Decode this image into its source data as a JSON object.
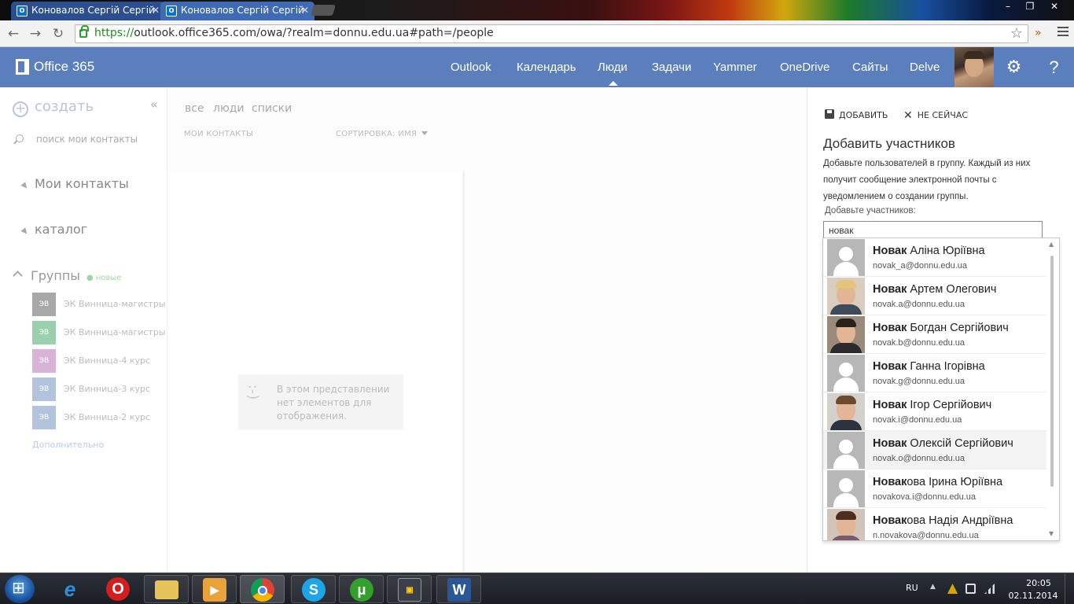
{
  "browser": {
    "tabs": [
      {
        "title": "Коновалов Сергій Сергій",
        "active": false
      },
      {
        "title": "Коновалов Сергій Сергій",
        "active": true
      }
    ],
    "tab_icon_text": "O",
    "url_scheme": "https://",
    "url_rest": "outlook.office365.com/owa/?realm=donnu.edu.ua#path=/people",
    "ext_chevron": "»"
  },
  "o365": {
    "brand": "Office 365",
    "nav": [
      "Outlook",
      "Календарь",
      "Люди",
      "Задачи",
      "Yammer",
      "OneDrive",
      "Сайты",
      "Delve"
    ],
    "active_nav": "Люди",
    "settings_glyph": "⚙",
    "help_glyph": "?"
  },
  "left_pane": {
    "create_label": "создать",
    "collapse_glyph": "«",
    "search_placeholder": "поиск мои контакты",
    "my_contacts": "Мои контакты",
    "directory": "каталог",
    "groups_label": "Группы",
    "groups_new_badge": "● новые",
    "groups": [
      {
        "initials": "ЭВ",
        "name": "ЭК Винница-магистры з",
        "color": "#a8a8a8"
      },
      {
        "initials": "ЭВ",
        "name": "ЭК Винница-магистры д",
        "color": "#9ccfae"
      },
      {
        "initials": "ЭВ",
        "name": "ЭК Винница-4 курс",
        "color": "#d8b3d9"
      },
      {
        "initials": "ЭВ",
        "name": "ЭК Винница-3 курс",
        "color": "#b2c3de"
      },
      {
        "initials": "ЭВ",
        "name": "ЭК Винница-2 курс",
        "color": "#b2c3de"
      }
    ],
    "more_link": "Дополнительно"
  },
  "middle_pane": {
    "filters": [
      "все",
      "люди",
      "списки"
    ],
    "my_contacts_header": "МОИ КОНТАКТЫ",
    "sort_label": "СОРТИРОВКА: ИМЯ",
    "empty_face": ":-)",
    "empty_message": "В этом представлении нет элементов для отображения."
  },
  "right_pane": {
    "save_label": "ДОБАВИТЬ",
    "dismiss_label": "НЕ СЕЙЧАС",
    "title": "Добавить участников",
    "description": "Добавьте пользователей в группу. Каждый из них получит сообщение электронной почты с уведомлением о создании группы.",
    "add_members_label": "Добавьте участников:",
    "input_value": "новак"
  },
  "suggestions": {
    "query_bold": "Новак",
    "items": [
      {
        "bold": "Новак",
        "rest": " Аліна Юріївна",
        "email": "novak_a@donnu.edu.ua",
        "photo": "placeholder"
      },
      {
        "bold": "Новак",
        "rest": " Артем Олегович",
        "email": "novak.a@donnu.edu.ua",
        "photo": "blond"
      },
      {
        "bold": "Новак",
        "rest": " Богдан Сергійович",
        "email": "novak.b@donnu.edu.ua",
        "photo": "dark"
      },
      {
        "bold": "Новак",
        "rest": " Ганна Ігорівна",
        "email": "novak.g@donnu.edu.ua",
        "photo": "placeholder"
      },
      {
        "bold": "Новак",
        "rest": " Ігор Сергійович",
        "email": "novak.i@donnu.edu.ua",
        "photo": "suit"
      },
      {
        "bold": "Новак",
        "rest": " Олексій Сергійович",
        "email": "novak.o@donnu.edu.ua",
        "photo": "placeholder",
        "highlighted": true
      },
      {
        "bold": "Новак",
        "rest": "ова Ірина Юріївна",
        "email": "novakova.i@donnu.edu.ua",
        "photo": "placeholder"
      },
      {
        "bold": "Новак",
        "rest": "ова Надія Андріївна",
        "email": "n.novakova@donnu.edu.ua",
        "photo": "woman"
      }
    ]
  },
  "taskbar": {
    "apps": [
      "internet-explorer",
      "opera",
      "file-explorer",
      "media-player",
      "chrome",
      "skype",
      "utorrent",
      "network-tool",
      "word"
    ],
    "language": "RU",
    "time": "20:05",
    "date": "02.11.2014"
  }
}
